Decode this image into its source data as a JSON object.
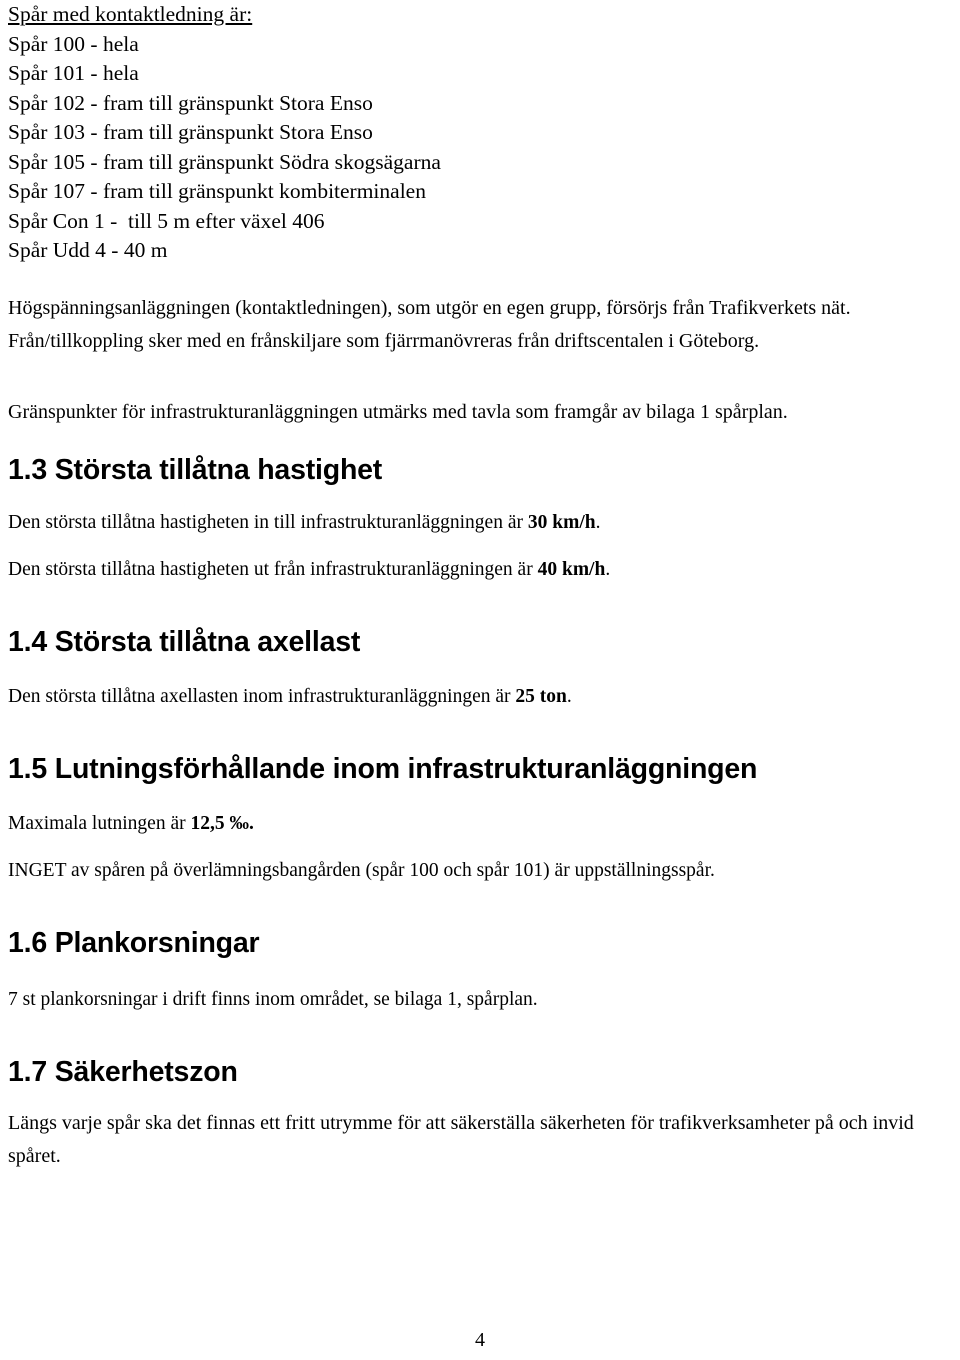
{
  "document": {
    "page_number": "4",
    "track_list": {
      "heading": "Spår med kontaktledning är:",
      "lines": [
        "Spår 100 - hela",
        "Spår 101 - hela",
        "Spår 102 - fram till gränspunkt Stora Enso",
        "Spår 103 - fram till gränspunkt Stora Enso",
        "Spår 105 - fram till gränspunkt Södra skogsägarna",
        "Spår 107 - fram till gränspunkt kombiterminalen",
        "Spår Con 1 -  till 5 m efter växel 406",
        "Spår Udd 4 - 40 m"
      ]
    },
    "paragraphs": {
      "high_voltage": "Högspänningsanläggningen (kontaktledningen), som utgör en egen grupp, försörjs från Trafikverkets nät. Från/tillkoppling sker med en frånskiljare som fjärrmanövreras från driftscentalen i Göteborg.",
      "boundary_points": "Gränspunkter för infrastrukturanläggningen utmärks med tavla som framgår av bilaga 1 spårplan."
    },
    "sections": [
      {
        "number": "1.3",
        "title": "1.3 Största tillåtna hastighet",
        "paragraphs": [
          {
            "prefix": "Den största tillåtna hastigheten in till infrastrukturanläggningen är ",
            "value": "30 km/h",
            "suffix": "."
          },
          {
            "prefix": "Den största tillåtna hastigheten ut från infrastrukturanläggningen är ",
            "value": "40 km/h",
            "suffix": "."
          }
        ]
      },
      {
        "number": "1.4",
        "title": "1.4 Största tillåtna axellast",
        "paragraphs": [
          {
            "prefix": "Den största tillåtna axellasten inom infrastrukturanläggningen är ",
            "value": "25 ton",
            "suffix": "."
          }
        ]
      },
      {
        "number": "1.5",
        "title": "1.5 Lutningsförhållande inom infrastrukturanläggningen",
        "paragraphs": [
          {
            "prefix": "Maximala lutningen är ",
            "value": "12,5 ‰.",
            "suffix": ""
          }
        ],
        "extra": "INGET av spåren på överlämningsbangården (spår 100 och spår 101) är uppställningsspår."
      },
      {
        "number": "1.6",
        "title": "1.6 Plankorsningar",
        "paragraphs": [
          {
            "prefix": "7 st plankorsningar i drift finns inom området, se bilaga 1, spårplan.",
            "value": "",
            "suffix": ""
          }
        ]
      },
      {
        "number": "1.7",
        "title": "1.7 Säkerhetszon",
        "paragraphs": [
          {
            "prefix": "Längs varje spår ska det finnas ett fritt utrymme för att säkerställa säkerheten för trafikverksamheter på och invid spåret.",
            "value": "",
            "suffix": ""
          }
        ]
      }
    ]
  }
}
